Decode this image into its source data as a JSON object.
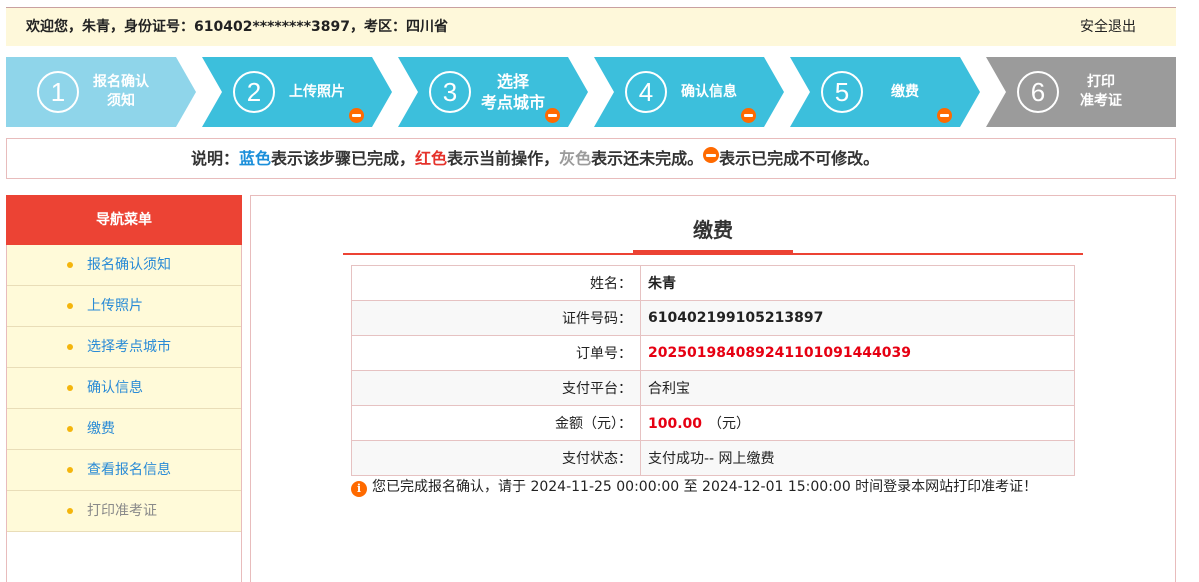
{
  "colors": {
    "top_bar_bg": "#fef8da",
    "top_bar_line": "#c9a0a0",
    "accent_red": "#ec4334",
    "badge_orange": "#ff6a00",
    "legend_blue": "#1b8fda",
    "legend_red": "#e5322b",
    "legend_grey": "#9b9b9b",
    "menu_link": "#2a8bd6",
    "menu_disabled": "#8a8a8a",
    "menu_bg": "#fffad9",
    "border_pink": "#e8bcbc",
    "value_red": "#e60012"
  },
  "icons": {
    "locked": "minus-circle-icon",
    "notice": "info-circle-icon"
  },
  "header": {
    "welcome_text": "欢迎您，朱青，身份证号：610402********3897，考区：四川省",
    "logout_label": "安全退出"
  },
  "steps": [
    {
      "number": "1",
      "lines": [
        "报名确认",
        "须知"
      ],
      "color": "#8fd5ea",
      "locked": false
    },
    {
      "number": "2",
      "lines": [
        "上传照片"
      ],
      "color": "#3cbfdc",
      "locked": true
    },
    {
      "number": "3",
      "lines": [
        "选择",
        "考点城市"
      ],
      "color": "#3cbfdc",
      "locked": true
    },
    {
      "number": "4",
      "lines": [
        "确认信息"
      ],
      "color": "#3cbfdc",
      "locked": true
    },
    {
      "number": "5",
      "lines": [
        "缴费"
      ],
      "color": "#3cbfdc",
      "locked": true
    },
    {
      "number": "6",
      "lines": [
        "打印",
        "准考证"
      ],
      "color": "#9b9b9b",
      "locked": false
    }
  ],
  "legend": {
    "prefix": "说明：",
    "blue_word": "蓝色",
    "blue_text": "表示该步骤已完成，",
    "red_word": "红色",
    "red_text": "表示当前操作，",
    "grey_word": "灰色",
    "grey_text": "表示还未完成。",
    "icon_text": "表示已完成不可修改。"
  },
  "sidebar": {
    "title": "导航菜单",
    "items": [
      {
        "label": "报名确认须知",
        "enabled": true
      },
      {
        "label": "上传照片",
        "enabled": true
      },
      {
        "label": "选择考点城市",
        "enabled": true
      },
      {
        "label": "确认信息",
        "enabled": true
      },
      {
        "label": "缴费",
        "enabled": true
      },
      {
        "label": "查看报名信息",
        "enabled": true
      },
      {
        "label": "打印准考证",
        "enabled": false
      }
    ]
  },
  "payment": {
    "title": "缴费",
    "rows": [
      {
        "label": "姓名：",
        "value": "朱青"
      },
      {
        "label": "证件号码：",
        "value": "610402199105213897"
      },
      {
        "label": "订单号：",
        "value": "202501984089241101091444039"
      },
      {
        "label": "支付平台：",
        "value": "合利宝"
      },
      {
        "label": "金额（元）：",
        "value": "100.00",
        "suffix": "（元）"
      },
      {
        "label": "支付状态：",
        "value": "支付成功-- 网上缴费"
      }
    ],
    "notice": "您已完成报名确认，请于 2024-11-25 00:00:00 至 2024-12-01 15:00:00 时间登录本网站打印准考证！"
  }
}
